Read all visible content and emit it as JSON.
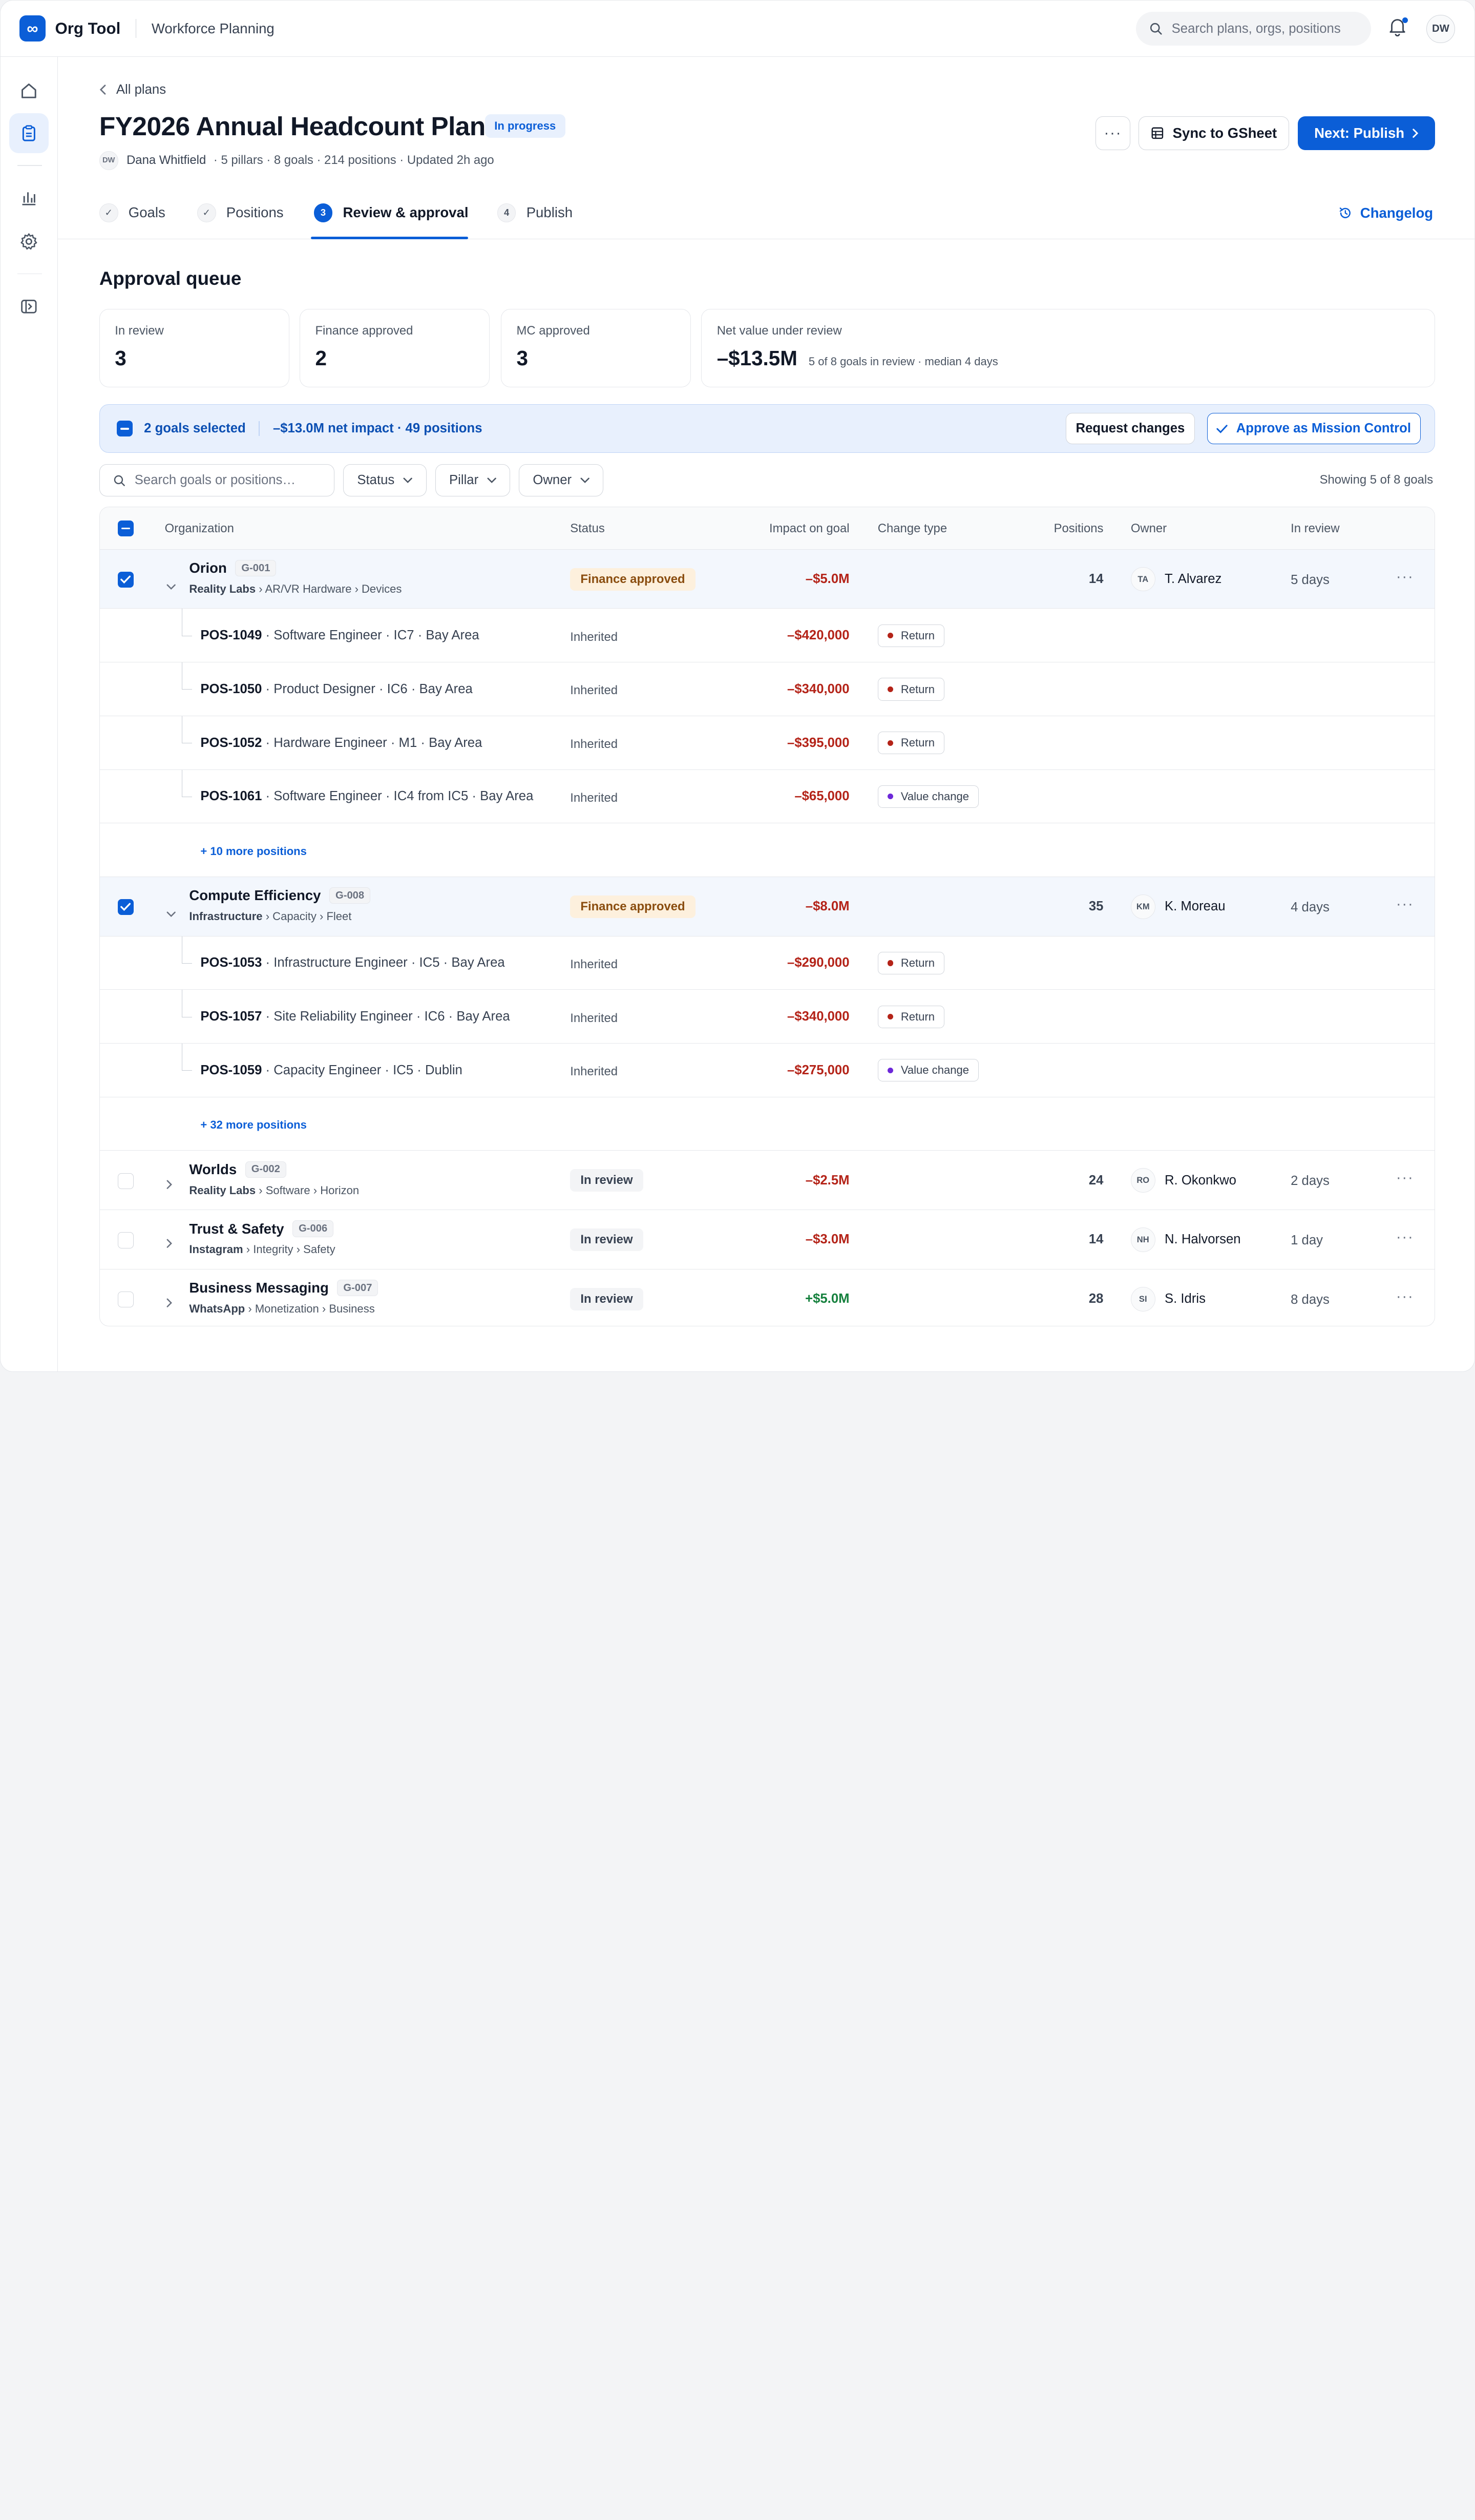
{
  "app": {
    "logo_glyph": "∞",
    "name": "Org Tool",
    "section": "Workforce Planning",
    "search_placeholder": "Search plans, orgs, positions",
    "user_initials": "DW",
    "brand_color": "#0b5ed7"
  },
  "rail": {
    "icons": [
      "home-icon",
      "clipboard-icon",
      "bar-chart-icon",
      "gear-icon",
      "sidebar-toggle-icon"
    ],
    "active": "clipboard-icon"
  },
  "header": {
    "back_label": "All plans",
    "title": "FY2026 Annual Headcount Plan",
    "status_badge": "In progress",
    "owner_initials": "DW",
    "owner_name": "Dana Whitfield",
    "meta": "· 5 pillars · 8 goals · 214 positions · Updated 2h ago",
    "more_label": "···",
    "sync_label": "Sync to GSheet",
    "publish_label": "Next: Publish"
  },
  "tabs": [
    {
      "num": "✓",
      "label": "Goals",
      "state": "done"
    },
    {
      "num": "✓",
      "label": "Positions",
      "state": "done"
    },
    {
      "num": "3",
      "label": "Review & approval",
      "state": "active"
    },
    {
      "num": "4",
      "label": "Publish",
      "state": "todo"
    }
  ],
  "changelog_label": "Changelog",
  "queue": {
    "title": "Approval queue",
    "stats": [
      {
        "label": "In review",
        "value": "3"
      },
      {
        "label": "Finance approved",
        "value": "2"
      },
      {
        "label": "MC approved",
        "value": "3"
      },
      {
        "label": "Net value under review",
        "value": "–$13.5M",
        "note": "5 of 8 goals in review · median 4 days"
      }
    ]
  },
  "selection": {
    "count": "2 goals selected",
    "impact": "–$13.0M net impact · 49 positions",
    "request_label": "Request changes",
    "approve_label": "Approve as Mission Control"
  },
  "filters": {
    "search_placeholder": "Search goals or positions…",
    "status": "Status",
    "pillar": "Pillar",
    "owner": "Owner",
    "showing": "Showing 5 of 8 goals"
  },
  "table": {
    "headers": {
      "organization": "Organization",
      "status": "Status",
      "impact": "Impact on goal",
      "change_type": "Change type",
      "positions": "Positions",
      "owner": "Owner",
      "in_review": "In review"
    },
    "goals": [
      {
        "name": "Orion",
        "id": "G-001",
        "pillar": "Reality Labs",
        "path": "› AR/VR Hardware › Devices",
        "status": "Finance approved",
        "impact": "–$5.0M",
        "positions": "14",
        "owner_initials": "TA",
        "owner": "T. Alvarez",
        "days": "5 days",
        "selected": true,
        "expanded": true,
        "children": [
          {
            "id": "POS-1049",
            "desc": "· Software Engineer · IC7 · Bay Area",
            "status": "Inherited",
            "impact": "–$420,000",
            "change": "Return"
          },
          {
            "id": "POS-1050",
            "desc": "· Product Designer · IC6 · Bay Area",
            "status": "Inherited",
            "impact": "–$340,000",
            "change": "Return"
          },
          {
            "id": "POS-1052",
            "desc": "· Hardware Engineer · M1 · Bay Area",
            "status": "Inherited",
            "impact": "–$395,000",
            "change": "Return"
          },
          {
            "id": "POS-1061",
            "desc": "· Software Engineer · IC4 from IC5 · Bay Area",
            "status": "Inherited",
            "impact": "–$65,000",
            "change": "Value change"
          }
        ],
        "more": "+ 10 more positions"
      },
      {
        "name": "Compute Efficiency",
        "id": "G-008",
        "pillar": "Infrastructure",
        "path": "› Capacity › Fleet",
        "status": "Finance approved",
        "impact": "–$8.0M",
        "positions": "35",
        "owner_initials": "KM",
        "owner": "K. Moreau",
        "days": "4 days",
        "selected": true,
        "expanded": true,
        "children": [
          {
            "id": "POS-1053",
            "desc": "· Infrastructure Engineer · IC5 · Bay Area",
            "status": "Inherited",
            "impact": "–$290,000",
            "change": "Return"
          },
          {
            "id": "POS-1057",
            "desc": "· Site Reliability Engineer · IC6 · Bay Area",
            "status": "Inherited",
            "impact": "–$340,000",
            "change": "Return"
          },
          {
            "id": "POS-1059",
            "desc": "· Capacity Engineer · IC5 · Dublin",
            "status": "Inherited",
            "impact": "–$275,000",
            "change": "Value change"
          }
        ],
        "more": "+ 32 more positions"
      },
      {
        "name": "Worlds",
        "id": "G-002",
        "pillar": "Reality Labs",
        "path": "› Software › Horizon",
        "status": "In review",
        "impact": "–$2.5M",
        "positions": "24",
        "owner_initials": "RO",
        "owner": "R. Okonkwo",
        "days": "2 days",
        "selected": false,
        "expanded": false
      },
      {
        "name": "Trust & Safety",
        "id": "G-006",
        "pillar": "Instagram",
        "path": "› Integrity › Safety",
        "status": "In review",
        "impact": "–$3.0M",
        "positions": "14",
        "owner_initials": "NH",
        "owner": "N. Halvorsen",
        "days": "1 day",
        "selected": false,
        "expanded": false
      },
      {
        "name": "Business Messaging",
        "id": "G-007",
        "pillar": "WhatsApp",
        "path": "› Monetization › Business",
        "status": "In review",
        "impact": "+$5.0M",
        "positions": "28",
        "owner_initials": "SI",
        "owner": "S. Idris",
        "days": "8 days",
        "selected": false,
        "expanded": false
      }
    ]
  }
}
